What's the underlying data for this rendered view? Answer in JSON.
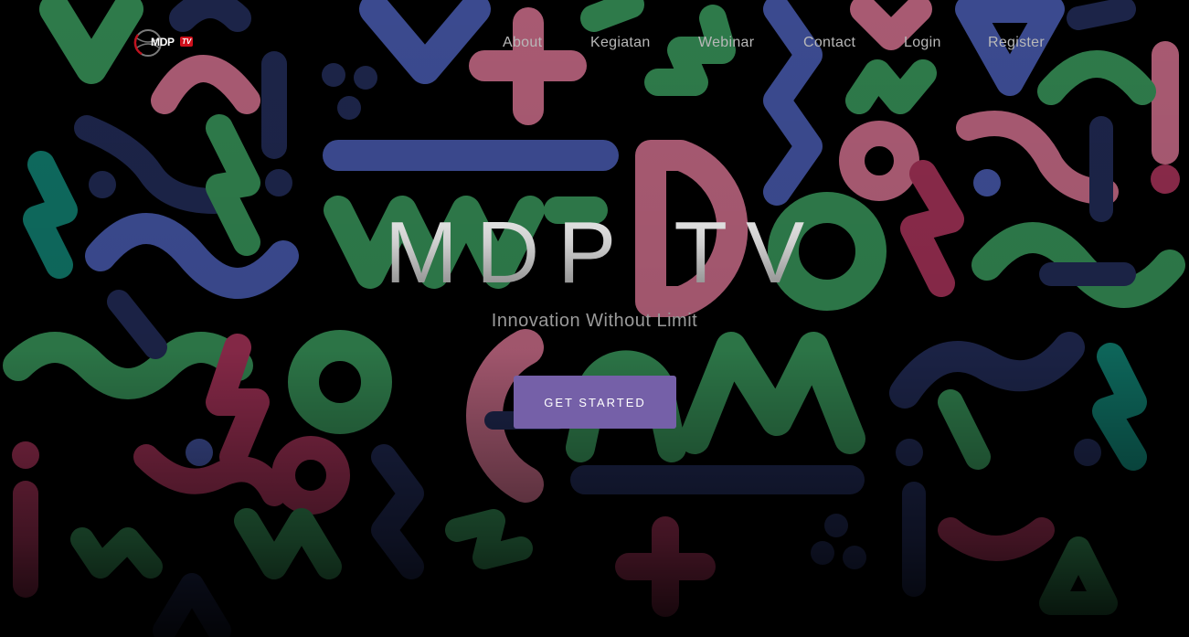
{
  "brand": {
    "logo_text": "MDP",
    "logo_badge": "TV",
    "accent_color": "#7560a8",
    "badge_color": "#d0101c"
  },
  "nav": {
    "items": [
      {
        "label": "About"
      },
      {
        "label": "Kegiatan"
      },
      {
        "label": "Webinar"
      },
      {
        "label": "Contact"
      },
      {
        "label": "Login"
      },
      {
        "label": "Register"
      }
    ]
  },
  "hero": {
    "title": "MDP TV",
    "subtitle": "Innovation Without Limit",
    "cta_label": "GET STARTED"
  },
  "background": {
    "pattern_colors": [
      "#2e7a4a",
      "#a85a72",
      "#3b4a8f",
      "#0e6a5e",
      "#8a2a4a",
      "#1c2448"
    ]
  }
}
